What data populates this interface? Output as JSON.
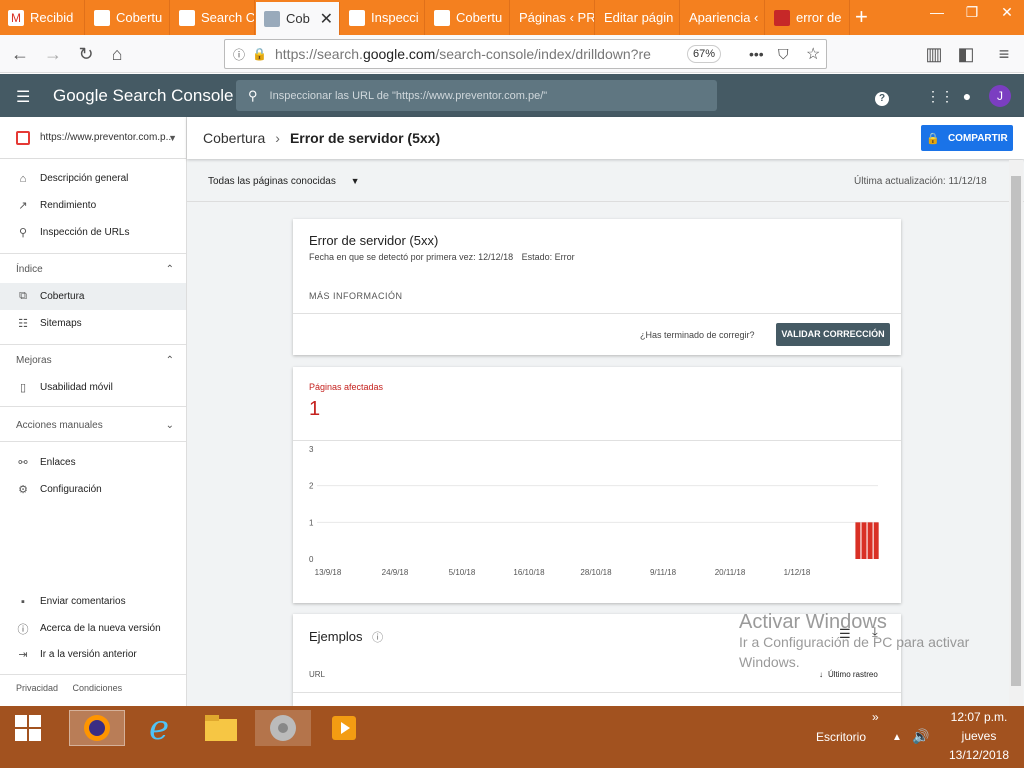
{
  "browser": {
    "tabs": [
      {
        "label": "Recibid",
        "active": false
      },
      {
        "label": "Cobertu",
        "active": false
      },
      {
        "label": "Search C",
        "active": false
      },
      {
        "label": "Cob",
        "active": true
      },
      {
        "label": "Inspecci",
        "active": false
      },
      {
        "label": "Cobertu",
        "active": false
      },
      {
        "label": "Páginas ‹ PR",
        "active": false
      },
      {
        "label": "Editar págin",
        "active": false
      },
      {
        "label": "Apariencia ‹",
        "active": false
      },
      {
        "label": "error de",
        "active": false
      }
    ],
    "url_prefix": "https://search.",
    "url_domain": "google.com",
    "url_path": "/search-console/index/drilldown?re",
    "zoom": "67%"
  },
  "header": {
    "app_name": "Google Search Console",
    "search_placeholder": "Inspeccionar las URL de \"https://www.preventor.com.pe/\"",
    "avatar_letter": "J"
  },
  "sidebar": {
    "property": "https://www.preventor.com.p...",
    "top_items": [
      {
        "label": "Descripción general"
      },
      {
        "label": "Rendimiento"
      },
      {
        "label": "Inspección de URLs"
      }
    ],
    "index_section": "Índice",
    "index_items": [
      {
        "label": "Cobertura"
      },
      {
        "label": "Sitemaps"
      }
    ],
    "improvements_section": "Mejoras",
    "improvements_items": [
      {
        "label": "Usabilidad móvil"
      }
    ],
    "manual_actions_section": "Acciones manuales",
    "other_items": [
      {
        "label": "Enlaces"
      },
      {
        "label": "Configuración"
      }
    ],
    "bottom_items": [
      {
        "label": "Enviar comentarios"
      },
      {
        "label": "Acerca de la nueva versión"
      },
      {
        "label": "Ir a la versión anterior"
      }
    ],
    "footer": {
      "privacy": "Privacidad",
      "terms": "Condiciones"
    }
  },
  "page": {
    "breadcrumb_parent": "Cobertura",
    "breadcrumb_current": "Error de servidor (5xx)",
    "share_label": "COMPARTIR",
    "filter_label": "Todas las páginas conocidas",
    "last_updated": "Última actualización: 11/12/18"
  },
  "issue_card": {
    "title": "Error de servidor (5xx)",
    "first_detected": "Fecha en que se detectó por primera vez: 12/12/18",
    "status": "Estado: Error",
    "more_info": "MÁS INFORMACIÓN",
    "fixed_question": "¿Has terminado de corregir?",
    "validate_label": "VALIDAR CORRECCIÓN"
  },
  "affected_card": {
    "label": "Páginas afectadas",
    "count": "1"
  },
  "chart_data": {
    "type": "bar",
    "y_ticks": [
      "3",
      "2",
      "1",
      "0"
    ],
    "ylim": [
      0,
      3
    ],
    "x_ticks": [
      "13/9/18",
      "24/9/18",
      "5/10/18",
      "16/10/18",
      "28/10/18",
      "9/11/18",
      "20/11/18",
      "1/12/18"
    ],
    "bars": [
      {
        "date": "9/12/18",
        "value": 1
      },
      {
        "date": "10/12/18",
        "value": 1
      },
      {
        "date": "11/12/18",
        "value": 1
      },
      {
        "date": "12/12/18",
        "value": 1
      }
    ],
    "bar_color": "#d93025",
    "grid": true
  },
  "examples_card": {
    "title": "Ejemplos",
    "url_header": "URL",
    "last_crawl_header": "Último rastreo"
  },
  "watermark": {
    "line1": "Activar Windows",
    "line2": "Ir a Configuración de PC para activar",
    "line3": "Windows."
  },
  "taskbar": {
    "desktop_label": "Escritorio",
    "time": "12:07 p.m.",
    "day": "jueves",
    "date": "13/12/2018"
  },
  "colors": {
    "firefox_tabbar": "#f4801f",
    "gsc_header": "#455a64",
    "accent_blue": "#1a73e8",
    "error_red": "#d93025",
    "taskbar": "#a2521f"
  }
}
